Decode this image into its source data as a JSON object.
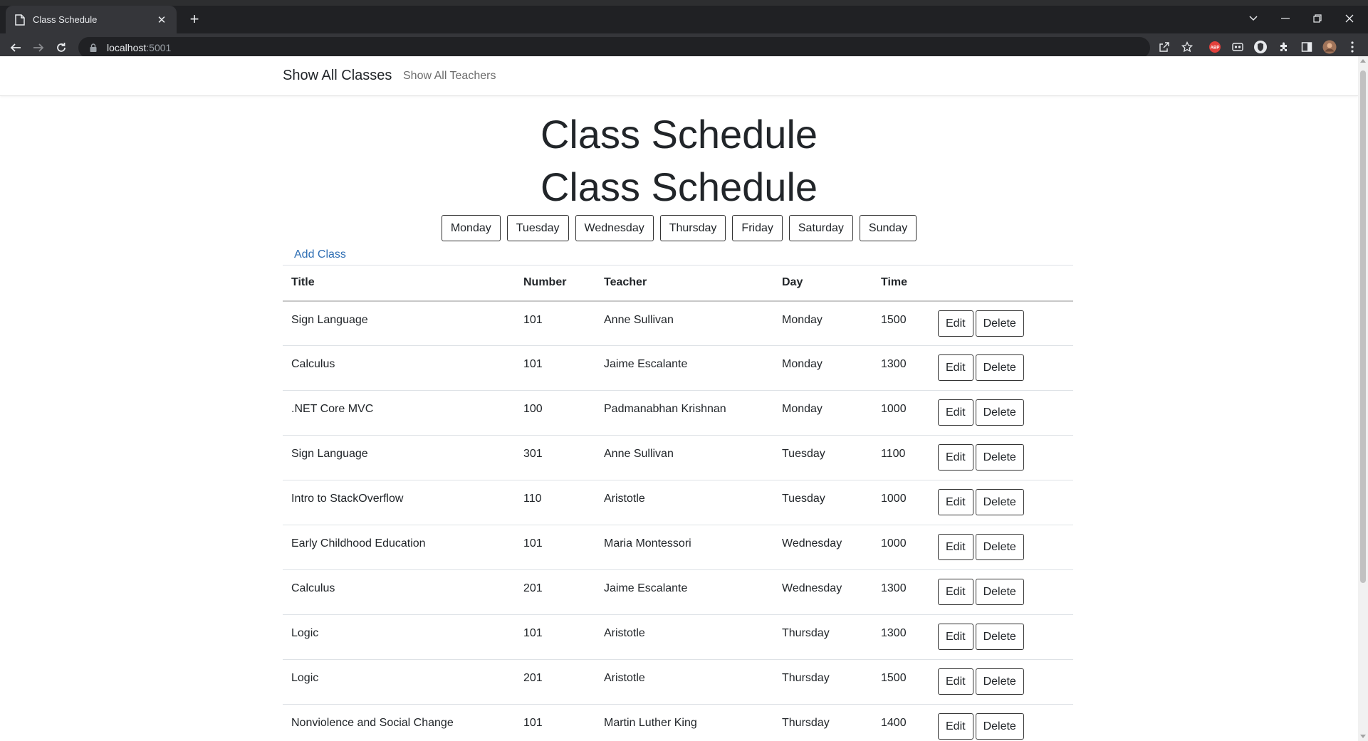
{
  "browser": {
    "tab_title": "Class Schedule",
    "url_host": "localhost",
    "url_port": ":5001"
  },
  "site_nav": {
    "brand": "Show All Classes",
    "teachers_link": "Show All Teachers"
  },
  "main": {
    "heading_1": "Class Schedule",
    "heading_2": "Class Schedule",
    "days": [
      "Monday",
      "Tuesday",
      "Wednesday",
      "Thursday",
      "Friday",
      "Saturday",
      "Sunday"
    ],
    "add_class_link": "Add Class",
    "table": {
      "headers": [
        "Title",
        "Number",
        "Teacher",
        "Day",
        "Time"
      ],
      "edit_label": "Edit",
      "delete_label": "Delete",
      "rows": [
        {
          "title": "Sign Language",
          "number": "101",
          "teacher": "Anne Sullivan",
          "day": "Monday",
          "time": "1500"
        },
        {
          "title": "Calculus",
          "number": "101",
          "teacher": "Jaime Escalante",
          "day": "Monday",
          "time": "1300"
        },
        {
          "title": ".NET Core MVC",
          "number": "100",
          "teacher": "Padmanabhan Krishnan",
          "day": "Monday",
          "time": "1000"
        },
        {
          "title": "Sign Language",
          "number": "301",
          "teacher": "Anne Sullivan",
          "day": "Tuesday",
          "time": "1100"
        },
        {
          "title": "Intro to StackOverflow",
          "number": "110",
          "teacher": "Aristotle",
          "day": "Tuesday",
          "time": "1000"
        },
        {
          "title": "Early Childhood Education",
          "number": "101",
          "teacher": "Maria Montessori",
          "day": "Wednesday",
          "time": "1000"
        },
        {
          "title": "Calculus",
          "number": "201",
          "teacher": "Jaime Escalante",
          "day": "Wednesday",
          "time": "1300"
        },
        {
          "title": "Logic",
          "number": "101",
          "teacher": "Aristotle",
          "day": "Thursday",
          "time": "1300"
        },
        {
          "title": "Logic",
          "number": "201",
          "teacher": "Aristotle",
          "day": "Thursday",
          "time": "1500"
        },
        {
          "title": "Nonviolence and Social Change",
          "number": "101",
          "teacher": "Martin Luther King",
          "day": "Thursday",
          "time": "1400"
        }
      ]
    }
  },
  "colors": {
    "link": "#2f6fb4",
    "chrome_dark": "#202124",
    "chrome_toolbar": "#35363a"
  }
}
